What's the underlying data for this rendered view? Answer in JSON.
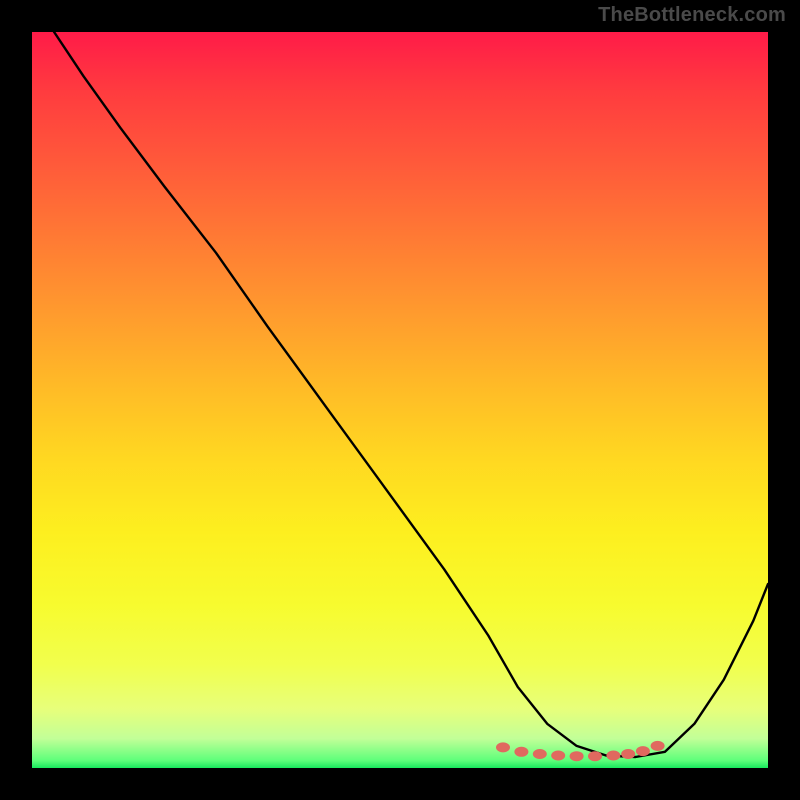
{
  "watermark": "TheBottleneck.com",
  "colors": {
    "background": "#000000",
    "watermark_text": "#4a4a4a",
    "marker": "#e0695f",
    "curve": "#000000",
    "gradient_top": "#ff1b48",
    "gradient_bottom": "#18e85d"
  },
  "chart_data": {
    "type": "line",
    "title": "",
    "xlabel": "",
    "ylabel": "",
    "xlim": [
      0,
      100
    ],
    "ylim": [
      0,
      100
    ],
    "note": "No numeric axes or tick labels are rendered; values are estimated positions in percent of plot area where y=0 is the optimal (bottom) region and y=100 is the worst (top).",
    "series": [
      {
        "name": "bottleneck-curve",
        "x": [
          3,
          7,
          12,
          18,
          25,
          32,
          40,
          48,
          56,
          62,
          66,
          70,
          74,
          78,
          82,
          86,
          90,
          94,
          98,
          100
        ],
        "y": [
          100,
          94,
          87,
          79,
          70,
          60,
          49,
          38,
          27,
          18,
          11,
          6,
          3,
          1.7,
          1.5,
          2.2,
          6,
          12,
          20,
          25
        ]
      }
    ],
    "markers": {
      "name": "optimal-region-dots",
      "x": [
        64,
        66.5,
        69,
        71.5,
        74,
        76.5,
        79,
        81,
        83,
        85
      ],
      "y": [
        2.8,
        2.2,
        1.9,
        1.7,
        1.6,
        1.6,
        1.7,
        1.9,
        2.3,
        3.0
      ]
    }
  }
}
